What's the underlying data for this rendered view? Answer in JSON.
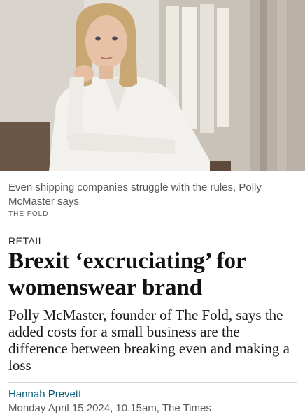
{
  "photo": {
    "subject": "portrait-photo"
  },
  "caption": "Even shipping companies struggle with the rules, Polly McMaster says",
  "credit": "THE FOLD",
  "section": "RETAIL",
  "headline": "Brexit ‘excruciating’ for womenswear brand",
  "standfirst": "Polly McMaster, founder of The Fold, says the added costs for a small business are the difference between breaking even and making a loss",
  "author": "Hannah Prevett",
  "dateline": "Monday April 15 2024, 10.15am, The Times"
}
